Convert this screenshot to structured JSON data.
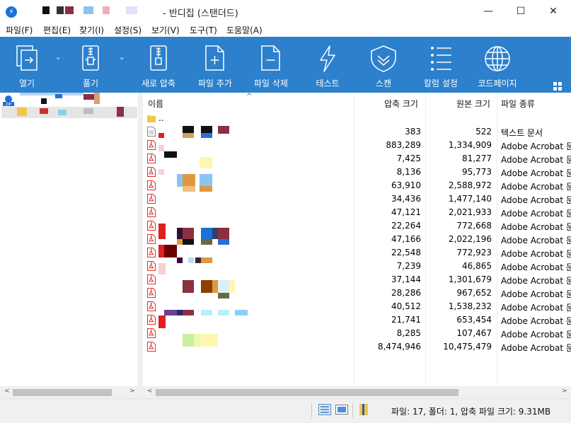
{
  "window": {
    "title": "- 반디집 (스탠더드)",
    "minimize": "—",
    "maximize": "☐",
    "close": "✕"
  },
  "menu": [
    "파일(F)",
    "편집(E)",
    "찾기(I)",
    "설정(S)",
    "보기(V)",
    "도구(T)",
    "도움말(A)"
  ],
  "toolbar": {
    "open": "열기",
    "extract": "풀기",
    "new_archive": "새로 압축",
    "add_file": "파일 추가",
    "delete_file": "파일 삭제",
    "test": "테스트",
    "scan": "스캔",
    "column_settings": "칼럼 설정",
    "codepage": "코드페이지",
    "dropdown_arrow": "⌄"
  },
  "columns": {
    "name": "이름",
    "compressed": "압축 크기",
    "original": "원본 크기",
    "type": "파일 종류",
    "sort_caret": "^"
  },
  "rows": [
    {
      "icon": "folder",
      "name": "..",
      "compressed": "",
      "original": "",
      "type": ""
    },
    {
      "icon": "text",
      "name": "",
      "compressed": "383",
      "original": "522",
      "type": "텍스트 문서"
    },
    {
      "icon": "pdf",
      "name": "",
      "compressed": "883,289",
      "original": "1,334,909",
      "type": "Adobe Acrobat 문"
    },
    {
      "icon": "pdf",
      "name": "",
      "compressed": "7,425",
      "original": "81,277",
      "type": "Adobe Acrobat 문"
    },
    {
      "icon": "pdf",
      "name": "",
      "compressed": "8,136",
      "original": "95,773",
      "type": "Adobe Acrobat 문"
    },
    {
      "icon": "pdf",
      "name": "",
      "compressed": "63,910",
      "original": "2,588,972",
      "type": "Adobe Acrobat 문"
    },
    {
      "icon": "pdf",
      "name": "",
      "compressed": "34,436",
      "original": "1,477,140",
      "type": "Adobe Acrobat 문"
    },
    {
      "icon": "pdf",
      "name": "",
      "compressed": "47,121",
      "original": "2,021,933",
      "type": "Adobe Acrobat 문"
    },
    {
      "icon": "pdf",
      "name": "",
      "compressed": "22,264",
      "original": "772,668",
      "type": "Adobe Acrobat 문"
    },
    {
      "icon": "pdf",
      "name": "",
      "compressed": "47,166",
      "original": "2,022,196",
      "type": "Adobe Acrobat 문"
    },
    {
      "icon": "pdf",
      "name": "",
      "compressed": "22,548",
      "original": "772,923",
      "type": "Adobe Acrobat 문"
    },
    {
      "icon": "pdf",
      "name": "",
      "compressed": "7,239",
      "original": "46,865",
      "type": "Adobe Acrobat 문"
    },
    {
      "icon": "pdf",
      "name": "",
      "compressed": "37,144",
      "original": "1,301,679",
      "type": "Adobe Acrobat 문"
    },
    {
      "icon": "pdf",
      "name": "",
      "compressed": "28,286",
      "original": "967,652",
      "type": "Adobe Acrobat 문"
    },
    {
      "icon": "pdf",
      "name": "",
      "compressed": "40,512",
      "original": "1,538,232",
      "type": "Adobe Acrobat 문"
    },
    {
      "icon": "pdf",
      "name": "",
      "compressed": "21,741",
      "original": "653,454",
      "type": "Adobe Acrobat 문"
    },
    {
      "icon": "pdf",
      "name": "",
      "compressed": "8,285",
      "original": "107,467",
      "type": "Adobe Acrobat 문"
    },
    {
      "icon": "pdf",
      "name": "",
      "compressed": "8,474,946",
      "original": "10,475,479",
      "type": "Adobe Acrobat 문"
    }
  ],
  "scroll": {
    "left_arrow": "<",
    "right_arrow": ">"
  },
  "status": {
    "summary": "파일: 17, 폴더: 1, 압축 파일 크기: 9.31MB"
  },
  "colors": {
    "toolbar": "#2c80cc",
    "pdf_red": "#d9322d",
    "folder": "#f3c649",
    "tree_selected": "#e5e5e5"
  }
}
